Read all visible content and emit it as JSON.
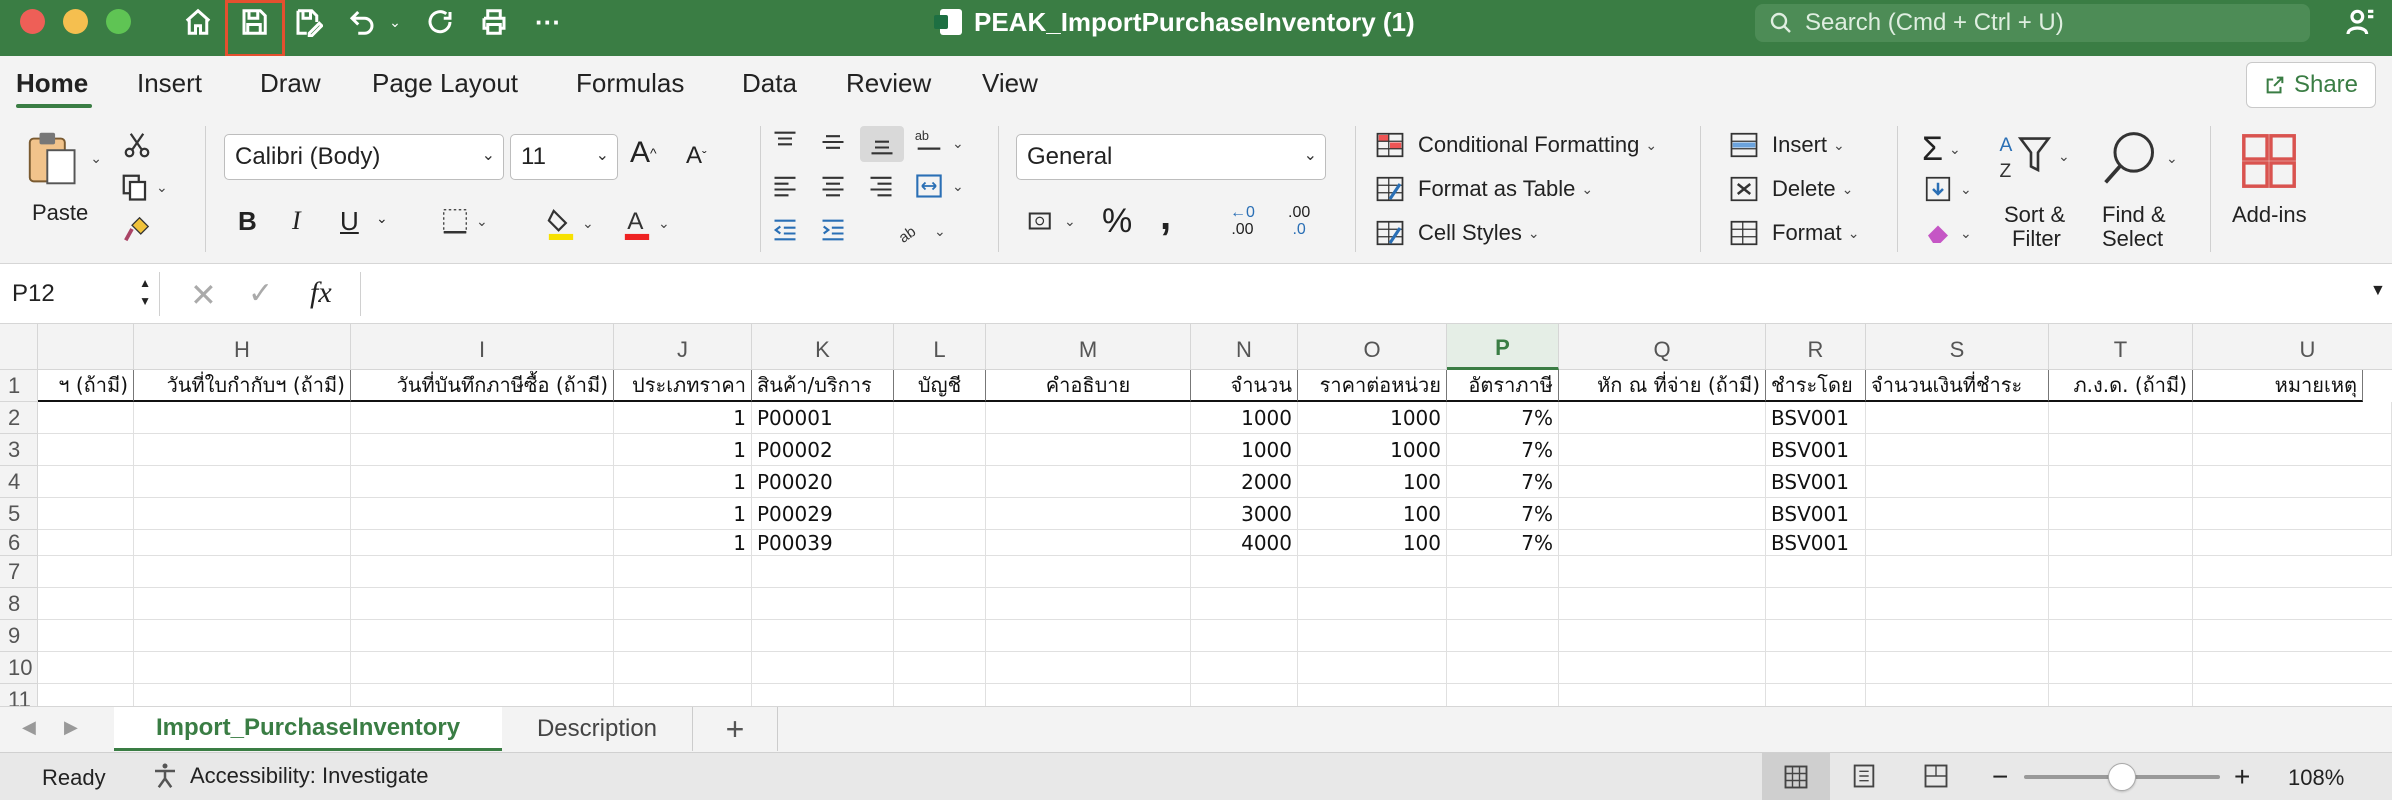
{
  "titlebar": {
    "title": "PEAK_ImportPurchaseInventory (1)",
    "search_placeholder": "Search (Cmd + Ctrl + U)",
    "colors": {
      "bar": "#3a7d44",
      "close": "#ee5f57",
      "minimize": "#f5bf4f",
      "zoom": "#5fc454",
      "highlight": "#e4502f"
    }
  },
  "ribbon_tabs": [
    "Home",
    "Insert",
    "Draw",
    "Page Layout",
    "Formulas",
    "Data",
    "Review",
    "View"
  ],
  "share_label": "Share",
  "ribbon": {
    "paste": "Paste",
    "font_name": "Calibri (Body)",
    "font_size": "11",
    "bold": "B",
    "italic": "I",
    "underline": "U",
    "number_format": "General",
    "conditional_formatting": "Conditional Formatting",
    "format_as_table": "Format as Table",
    "cell_styles": "Cell Styles",
    "insert": "Insert",
    "delete": "Delete",
    "format": "Format",
    "sort_filter_1": "Sort &",
    "sort_filter_2": "Filter",
    "find_select_1": "Find &",
    "find_select_2": "Select",
    "addins": "Add-ins",
    "percent": "%",
    "comma": ",",
    "dec_inc": ".00",
    "dec_dec": ".0"
  },
  "formula_bar": {
    "name_box": "P12",
    "fx": "fx",
    "content": ""
  },
  "columns": [
    "H",
    "I",
    "J",
    "K",
    "L",
    "M",
    "N",
    "O",
    "P",
    "Q",
    "R",
    "S",
    "T",
    "U"
  ],
  "selected_column": "P",
  "row_numbers": [
    "1",
    "2",
    "3",
    "4",
    "5",
    "6",
    "7",
    "8",
    "9",
    "10",
    "11"
  ],
  "headers": {
    "G": "ฯ (ถ้ามี)",
    "H": "วันที่ใบกำกับฯ (ถ้ามี)",
    "I": "วันที่บันทึกภาษีซื้อ (ถ้ามี)",
    "J": "ประเภทราคา",
    "K": "สินค้า/บริการ",
    "L": "บัญชี",
    "M": "คำอธิบาย",
    "N": "จำนวน",
    "O": "ราคาต่อหน่วย",
    "P": "อัตราภาษี",
    "Q": "หัก ณ ที่จ่าย (ถ้ามี)",
    "R": "ชำระโดย",
    "S": "จำนวนเงินที่ชำระ",
    "T": "ภ.ง.ด. (ถ้ามี)",
    "U": "หมายเหตุ"
  },
  "rows": [
    {
      "J": "1",
      "K": "P00001",
      "N": "1000",
      "O": "1000",
      "P": "7%",
      "R": "BSV001"
    },
    {
      "J": "1",
      "K": "P00002",
      "N": "1000",
      "O": "1000",
      "P": "7%",
      "R": "BSV001"
    },
    {
      "J": "1",
      "K": "P00020",
      "N": "2000",
      "O": "100",
      "P": "7%",
      "R": "BSV001"
    },
    {
      "J": "1",
      "K": "P00029",
      "N": "3000",
      "O": "100",
      "P": "7%",
      "R": "BSV001"
    },
    {
      "J": "1",
      "K": "P00039",
      "N": "4000",
      "O": "100",
      "P": "7%",
      "R": "BSV001"
    }
  ],
  "sheets": [
    "Import_PurchaseInventory",
    "Description"
  ],
  "add_sheet": "+",
  "status": {
    "ready": "Ready",
    "accessibility": "Accessibility: Investigate",
    "zoom": "108%",
    "zoom_minus": "−",
    "zoom_plus": "+"
  }
}
